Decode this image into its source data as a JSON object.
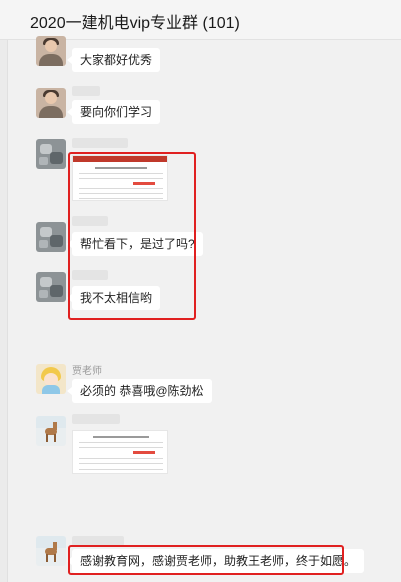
{
  "chat": {
    "title": "2020一建机电vip专业群 (101)"
  },
  "messages": [
    {
      "type": "text",
      "avatar": "person-icon",
      "text": "大家都好优秀"
    },
    {
      "type": "text",
      "avatar": "person-icon",
      "text": "要向你们学习"
    },
    {
      "type": "image",
      "avatar": "grey-pattern-icon",
      "content": "score-screenshot"
    },
    {
      "type": "text",
      "avatar": "grey-pattern-icon",
      "text": "帮忙看下，是过了吗?"
    },
    {
      "type": "text",
      "avatar": "grey-pattern-icon",
      "text": "我不太相信哟"
    },
    {
      "type": "text",
      "avatar": "cartoon-girl-icon",
      "sender": "贾老师",
      "text": "必须的 恭喜哦@陈劲松"
    },
    {
      "type": "image",
      "avatar": "deer-icon",
      "content": "score-screenshot"
    },
    {
      "type": "text",
      "avatar": "deer-icon",
      "text": "感谢教育网，感谢贾老师，助教王老师，终于如愿。"
    }
  ],
  "colors": {
    "background": "#f1f1f1",
    "bubble": "#ffffff",
    "highlight_box": "#e02020"
  }
}
